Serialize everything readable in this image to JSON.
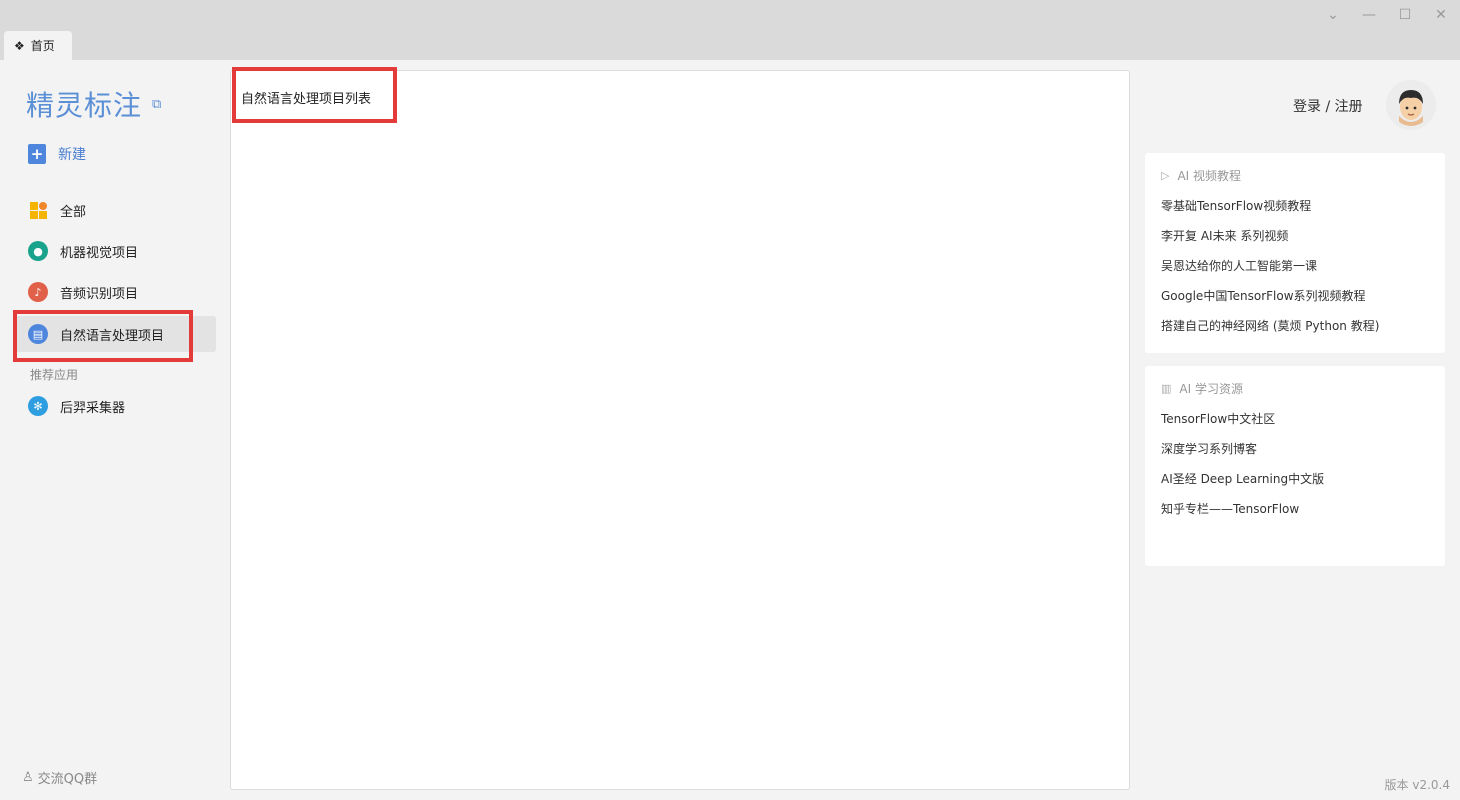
{
  "window": {
    "tab_icon": "❖",
    "tab_label": "首页",
    "controls": [
      "⌄",
      "—",
      "☐",
      "✕"
    ]
  },
  "sidebar": {
    "brand": "精灵标注",
    "brand_ext_icon": "⧉",
    "new_label": "新建",
    "items": [
      {
        "label": "全部",
        "icon": "grid-icon"
      },
      {
        "label": "机器视觉项目",
        "icon": "bulb-icon"
      },
      {
        "label": "音频识别项目",
        "icon": "music-icon"
      },
      {
        "label": "自然语言处理项目",
        "icon": "document-icon"
      }
    ],
    "section_label": "推荐应用",
    "app_label": "后羿采集器",
    "qq_label": "交流QQ群"
  },
  "main": {
    "title": "自然语言处理项目列表"
  },
  "right": {
    "login_label": "登录 / 注册",
    "video_card": {
      "title": "AI 视频教程",
      "links": [
        "零基础TensorFlow视频教程",
        "李开复 AI未来 系列视频",
        "吴恩达给你的人工智能第一课",
        "Google中国TensorFlow系列视频教程",
        "搭建自己的神经网络 (莫烦 Python 教程)"
      ]
    },
    "resource_card": {
      "title": "AI 学习资源",
      "links": [
        "TensorFlow中文社区",
        "深度学习系列博客",
        "AI圣经 Deep Learning中文版",
        "知乎专栏——TensorFlow"
      ]
    }
  },
  "footer": {
    "version": "版本 v2.0.4"
  },
  "colors": {
    "accent": "#5b8fd6",
    "highlight": "#e33a3a"
  }
}
